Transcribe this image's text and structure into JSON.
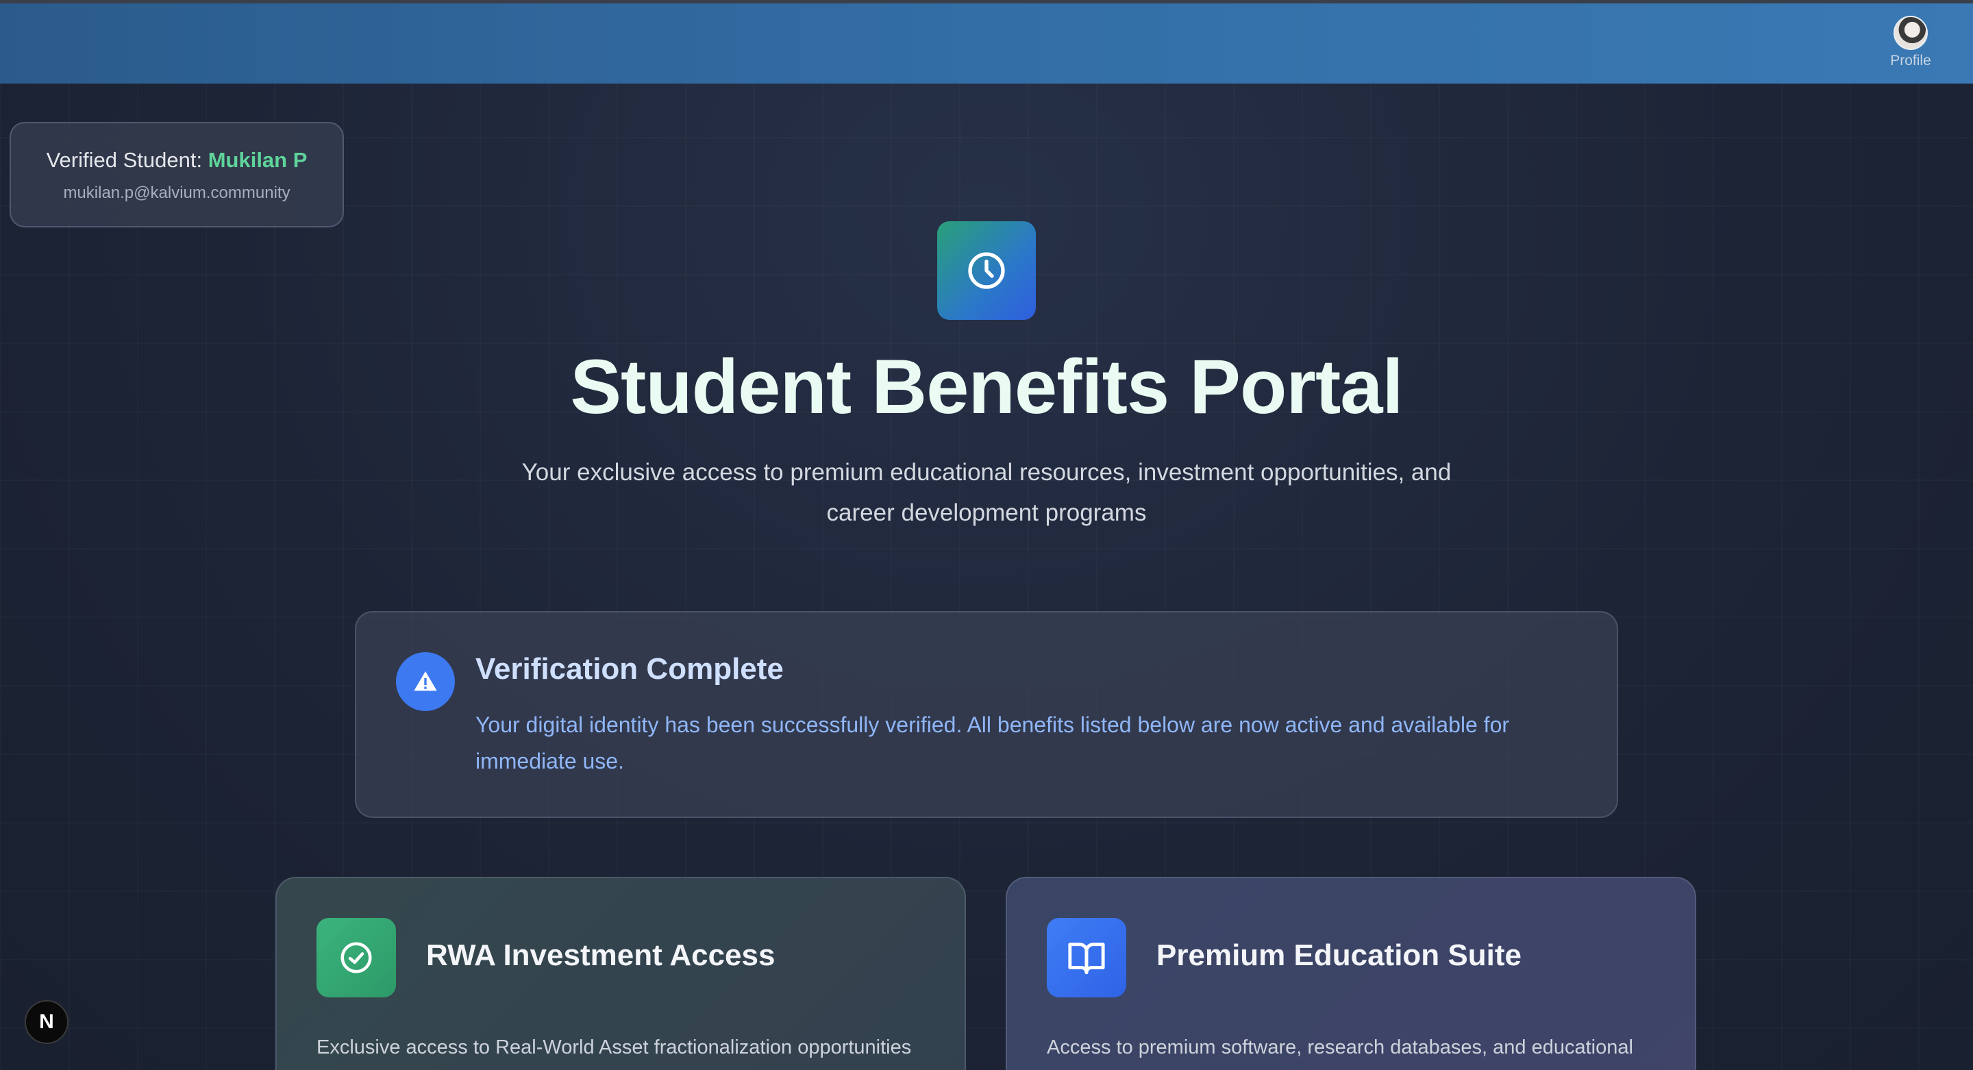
{
  "header": {
    "profile_label": "Profile"
  },
  "student": {
    "prefix": "Verified Student: ",
    "name": "Mukilan P",
    "email": "mukilan.p@kalvium.community"
  },
  "hero": {
    "icon": "clock-icon",
    "title": "Student Benefits Portal",
    "subtitle": "Your exclusive access to premium educational resources, investment opportunities, and career development programs"
  },
  "verification": {
    "icon": "warning-icon",
    "title": "Verification Complete",
    "text": "Your digital identity has been successfully verified. All benefits listed below are now active and available for immediate use."
  },
  "benefits": [
    {
      "icon": "check-circle-icon",
      "title": "RWA Investment Access",
      "description": "Exclusive access to Real-World Asset fractionalization opportunities with reduced minimum investment thresholds for verified students."
    },
    {
      "icon": "book-open-icon",
      "title": "Premium Education Suite",
      "description": "Access to premium software, research databases, and educational tools at no cost to verified students."
    }
  ],
  "dev_badge": {
    "label": "N"
  },
  "colors": {
    "topbar": "#336ea6",
    "accent_green": "#5fd39a",
    "accent_blue": "#3d7af2",
    "background": "#1b2233"
  }
}
